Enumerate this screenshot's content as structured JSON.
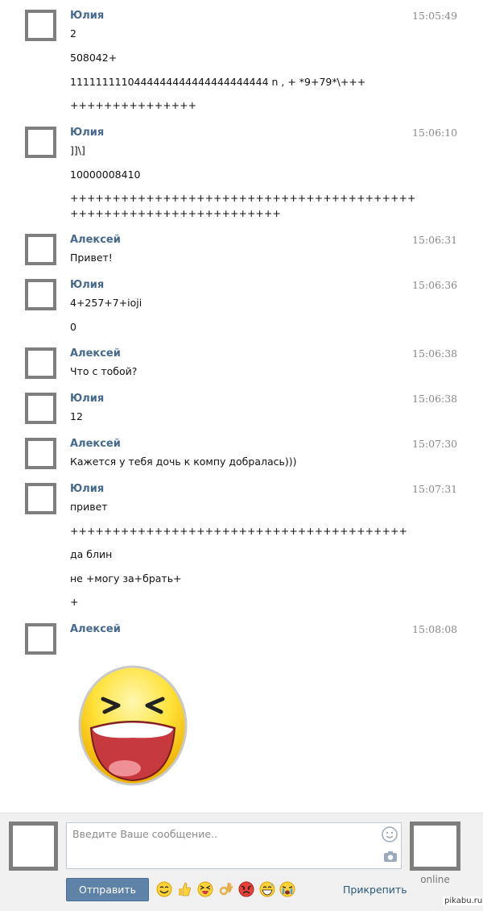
{
  "messages": [
    {
      "author": "Юлия",
      "time": "15:05:49",
      "lines": [
        "2",
        "508042+",
        "1111111110444444444444444444444 n , + *9+79*\\+++",
        "+++++++++++++++"
      ]
    },
    {
      "author": "Юлия",
      "time": "15:06:10",
      "lines": [
        "]]\\]",
        "10000008410",
        "+++++++++++++++++++++++++++++++++++++++++",
        "+++++++++++++++++++++++++"
      ]
    },
    {
      "author": "Алексей",
      "time": "15:06:31",
      "lines": [
        "Привет!"
      ]
    },
    {
      "author": "Юлия",
      "time": "15:06:36",
      "lines": [
        "4+257+7+ioji",
        "0"
      ]
    },
    {
      "author": "Алексей",
      "time": "15:06:38",
      "lines": [
        "Что с тобой?"
      ]
    },
    {
      "author": "Юлия",
      "time": "15:06:38",
      "lines": [
        "12"
      ]
    },
    {
      "author": "Алексей",
      "time": "15:07:30",
      "lines": [
        "Кажется у тебя дочь к компу добралась)))"
      ]
    },
    {
      "author": "Юлия",
      "time": "15:07:31",
      "lines": [
        "привет",
        "++++++++++++++++++++++++++++++++++++++++",
        "да блин",
        "не +могу за+брать+",
        "+"
      ]
    },
    {
      "author": "Алексей",
      "time": "15:08:08",
      "lines": [],
      "sticker": "laughing-smiley-sticker"
    }
  ],
  "composer": {
    "placeholder": "Введите Ваше сообщение..",
    "send_label": "Отправить",
    "attach_label": "Прикрепить",
    "peer_status": "online",
    "emoji_icons": [
      "smile-emoji-icon",
      "thumbs-up-emoji-icon",
      "squint-tongue-emoji-icon",
      "ok-hand-emoji-icon",
      "angry-emoji-icon",
      "grin-sweat-emoji-icon",
      "crying-emoji-icon"
    ]
  },
  "watermark": "pikabu.ru",
  "colors": {
    "author": "#45688e",
    "button": "#5e82a8",
    "avatar_border": "#7e7e7e"
  }
}
